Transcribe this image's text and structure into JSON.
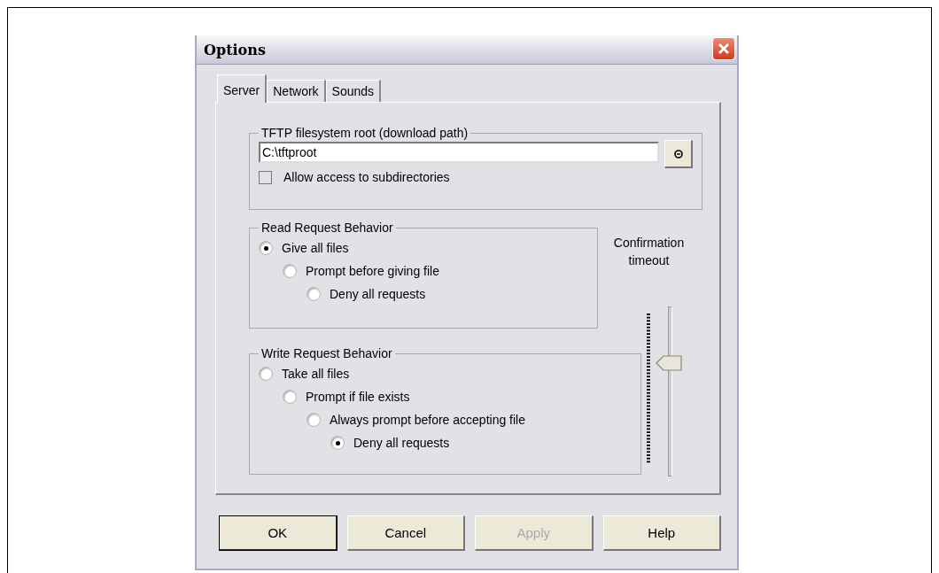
{
  "window": {
    "title": "Options"
  },
  "tabs": [
    {
      "label": "Server",
      "selected": true
    },
    {
      "label": "Network",
      "selected": false
    },
    {
      "label": "Sounds",
      "selected": false
    }
  ],
  "root_group": {
    "title": "TFTP filesystem root (download path)",
    "path": {
      "value": "C:\\tftproot"
    },
    "subdirectories": {
      "label": "Allow access to subdirectories",
      "checked": false
    }
  },
  "read_group": {
    "title": "Read Request Behavior",
    "options": [
      {
        "label": "Give all files",
        "selected": true
      },
      {
        "label": "Prompt before giving file",
        "selected": false
      },
      {
        "label": "Deny all requests",
        "selected": false
      }
    ]
  },
  "write_group": {
    "title": "Write Request Behavior",
    "options": [
      {
        "label": "Take all files",
        "selected": false
      },
      {
        "label": "Prompt if file exists",
        "selected": false
      },
      {
        "label": "Always prompt before accepting file",
        "selected": false
      },
      {
        "label": "Deny all requests",
        "selected": true
      }
    ]
  },
  "confirmation_timeout": {
    "label": "Confirmation timeout",
    "level": 0.68
  },
  "buttons": [
    {
      "label": "OK",
      "default": true,
      "disabled": false
    },
    {
      "label": "Cancel",
      "default": false,
      "disabled": false
    },
    {
      "label": "Apply",
      "default": false,
      "disabled": true
    },
    {
      "label": "Help",
      "default": false,
      "disabled": false
    }
  ]
}
